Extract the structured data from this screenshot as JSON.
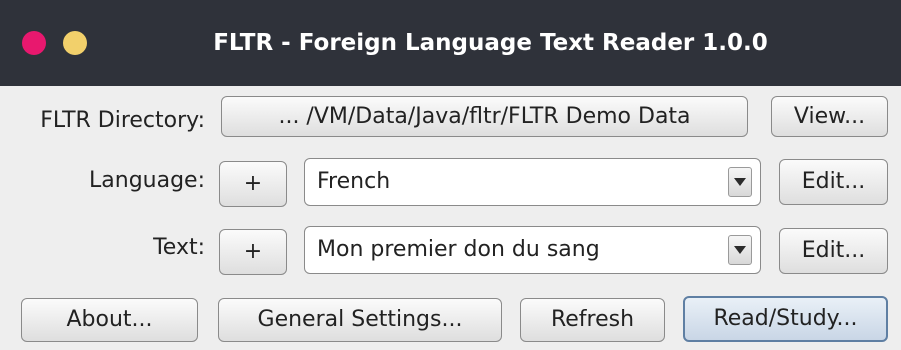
{
  "window": {
    "title": "FLTR - Foreign Language Text Reader 1.0.0",
    "controls": {
      "close_color": "#e8186e",
      "minimize_color": "#f2d06b"
    }
  },
  "directory": {
    "label": "FLTR Directory:",
    "path_button": "... /VM/Data/Java/fltr/FLTR Demo Data",
    "view_button": "View..."
  },
  "language": {
    "label": "Language:",
    "add_button": "+",
    "selected": "French",
    "edit_button": "Edit..."
  },
  "text": {
    "label": "Text:",
    "add_button": "+",
    "selected": "Mon premier don du sang",
    "edit_button": "Edit..."
  },
  "footer": {
    "about_button": "About...",
    "settings_button": "General Settings...",
    "refresh_button": "Refresh",
    "read_button": "Read/Study..."
  },
  "icons": {
    "dropdown": "chevron-down-icon"
  }
}
